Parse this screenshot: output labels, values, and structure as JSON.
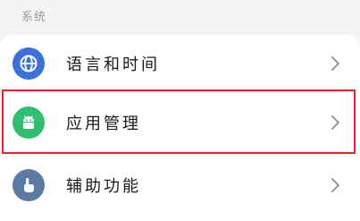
{
  "section": {
    "title": "系统"
  },
  "items": [
    {
      "label": "语言和时间",
      "icon": "globe-icon",
      "color": "#3a6fe0"
    },
    {
      "label": "应用管理",
      "icon": "android-icon",
      "color": "#2fbf71"
    },
    {
      "label": "辅助功能",
      "icon": "hand-pointer-icon",
      "color": "#5b7aa6"
    }
  ],
  "highlight": {
    "color": "#e8222a",
    "target": "应用管理"
  }
}
